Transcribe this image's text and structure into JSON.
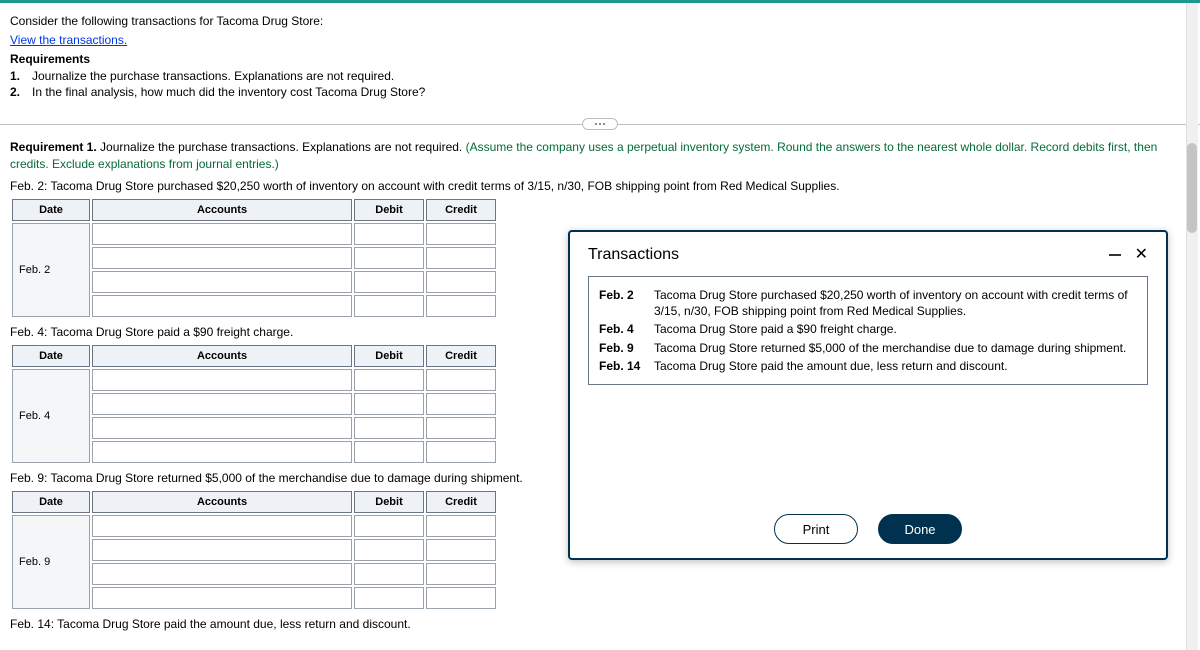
{
  "intro": {
    "line1": "Consider the following transactions for Tacoma Drug Store:",
    "link": "View the transactions.",
    "req_heading": "Requirements",
    "req1_num": "1.",
    "req1_text": "Journalize the purchase transactions. Explanations are not required.",
    "req2_num": "2.",
    "req2_text": "In the final analysis, how much did the inventory cost Tacoma Drug Store?"
  },
  "requirement1": {
    "label": "Requirement 1.",
    "text": " Journalize the purchase transactions. Explanations are not required. ",
    "note": "(Assume the company uses a perpetual inventory system. Round the answers to the nearest whole dollar. Record debits first, then credits. Exclude explanations from journal entries.)"
  },
  "journal_headers": {
    "date": "Date",
    "accounts": "Accounts",
    "debit": "Debit",
    "credit": "Credit"
  },
  "entries": [
    {
      "prompt_prefix": "Feb. 2: Tacoma Drug Store",
      "prompt_rest": " purchased $20,250 worth of inventory on account with credit terms of 3/15, n/30, FOB shipping point from ",
      "prompt_suffix": "Red Medical Supplies.",
      "date": "Feb. 2"
    },
    {
      "prompt_prefix": "Feb. 4: Tacoma Drug Store",
      "prompt_rest": " paid a $90 freight charge.",
      "prompt_suffix": "",
      "date": "Feb. 4"
    },
    {
      "prompt_prefix": "Feb. 9: Tacoma Drug Store",
      "prompt_rest": " returned $5,000 of the merchandise due to damage during shipment.",
      "prompt_suffix": "",
      "date": "Feb. 9"
    },
    {
      "prompt_prefix": "Feb. 14: Tacoma Drug Store",
      "prompt_rest": " paid the amount due, less return and discount.",
      "prompt_suffix": "",
      "date": "Feb. 14"
    }
  ],
  "popup": {
    "title": "Transactions",
    "rows": [
      {
        "date": "Feb. 2",
        "desc": "Tacoma Drug Store purchased $20,250 worth of inventory on account with credit terms of 3/15, n/30, FOB shipping point from Red Medical Supplies."
      },
      {
        "date": "Feb. 4",
        "desc": "Tacoma Drug Store paid a $90 freight charge."
      },
      {
        "date": "Feb. 9",
        "desc": "Tacoma Drug Store returned $5,000 of the merchandise due to damage during shipment."
      },
      {
        "date": "Feb. 14",
        "desc": "Tacoma Drug Store paid the amount due, less return and discount."
      }
    ],
    "print": "Print",
    "done": "Done"
  }
}
